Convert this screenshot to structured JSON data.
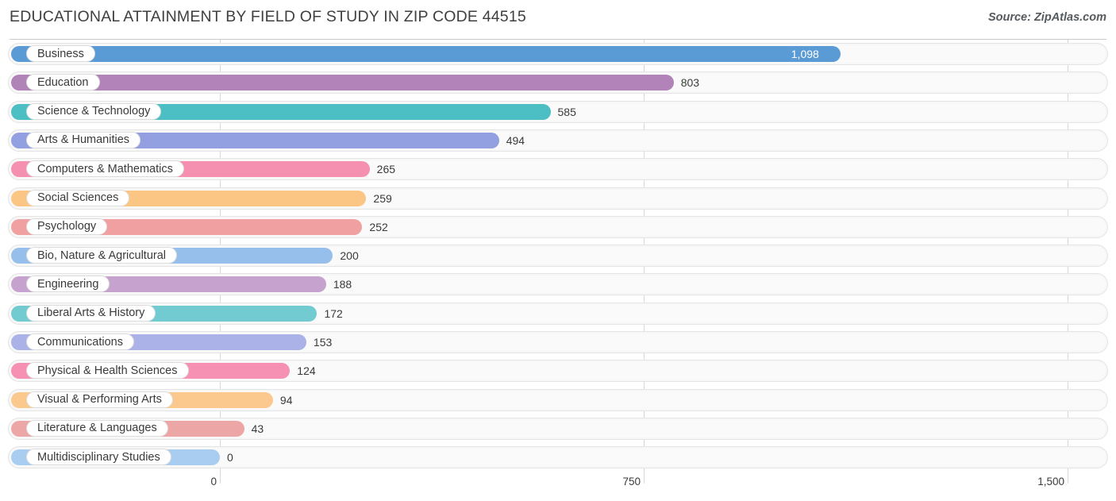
{
  "header": {
    "title": "EDUCATIONAL ATTAINMENT BY FIELD OF STUDY IN ZIP CODE 44515",
    "source": "Source: ZipAtlas.com"
  },
  "chart_data": {
    "type": "bar",
    "orientation": "horizontal",
    "title": "EDUCATIONAL ATTAINMENT BY FIELD OF STUDY IN ZIP CODE 44515",
    "subtitle": "",
    "xlabel": "",
    "ylabel": "",
    "xlim": [
      0,
      1500
    ],
    "grid": true,
    "legend": null,
    "axis_ticks": [
      "0",
      "750",
      "1,500"
    ],
    "axis_tick_values": [
      0,
      750,
      1500
    ],
    "categories": [
      "Business",
      "Education",
      "Science & Technology",
      "Arts & Humanities",
      "Computers & Mathematics",
      "Social Sciences",
      "Psychology",
      "Bio, Nature & Agricultural",
      "Engineering",
      "Liberal Arts & History",
      "Communications",
      "Physical & Health Sciences",
      "Visual & Performing Arts",
      "Literature & Languages",
      "Multidisciplinary Studies"
    ],
    "values": [
      1098,
      803,
      585,
      494,
      265,
      259,
      252,
      200,
      188,
      172,
      153,
      124,
      94,
      43,
      0
    ],
    "value_labels": [
      "1,098",
      "803",
      "585",
      "494",
      "265",
      "259",
      "252",
      "200",
      "188",
      "172",
      "153",
      "124",
      "94",
      "43",
      "0"
    ],
    "colors": [
      "#5b9bd5",
      "#b183b8",
      "#4bbfc4",
      "#929fe0",
      "#f590b0",
      "#fbc684",
      "#f0a0a0",
      "#96bfeb",
      "#c6a3ce",
      "#71cbd1",
      "#aab2e8",
      "#f691b4",
      "#fbc98e",
      "#eda6a6",
      "#a9cdf0"
    ]
  }
}
